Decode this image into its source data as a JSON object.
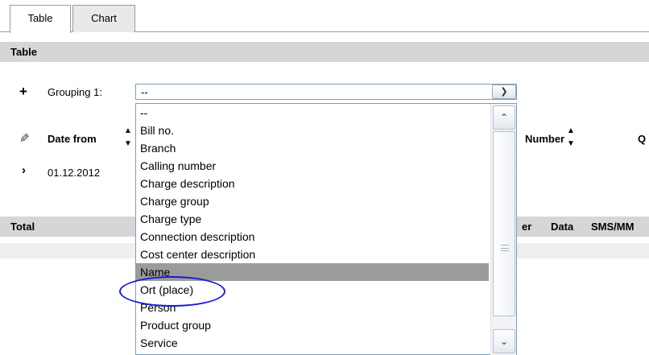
{
  "tabs": [
    {
      "label": "Table",
      "active": true
    },
    {
      "label": "Chart",
      "active": false
    }
  ],
  "table_section": {
    "title": "Table"
  },
  "grouping": {
    "label": "Grouping 1:",
    "selected_value": "--"
  },
  "columns": {
    "date_from": "Date from",
    "number": "Number",
    "q_partial": "Q"
  },
  "rows": [
    {
      "date": "01.12.2012"
    }
  ],
  "total_section": {
    "title": "Total",
    "headers_partial": [
      "er",
      "Data",
      "SMS/MM"
    ]
  },
  "dropdown": {
    "options": [
      "--",
      "Bill no.",
      "Branch",
      "Calling number",
      "Charge description",
      "Charge group",
      "Charge type",
      "Connection description",
      "Cost center description",
      "Name",
      "Ort (place)",
      "Person",
      "Product group",
      "Service"
    ],
    "highlighted": "Name",
    "circled": "Ort (place)"
  },
  "colors": {
    "header_bar": "#d6d6d6",
    "selected_option": "#9b9b9b",
    "annotation_ellipse": "#1a1ad6"
  }
}
